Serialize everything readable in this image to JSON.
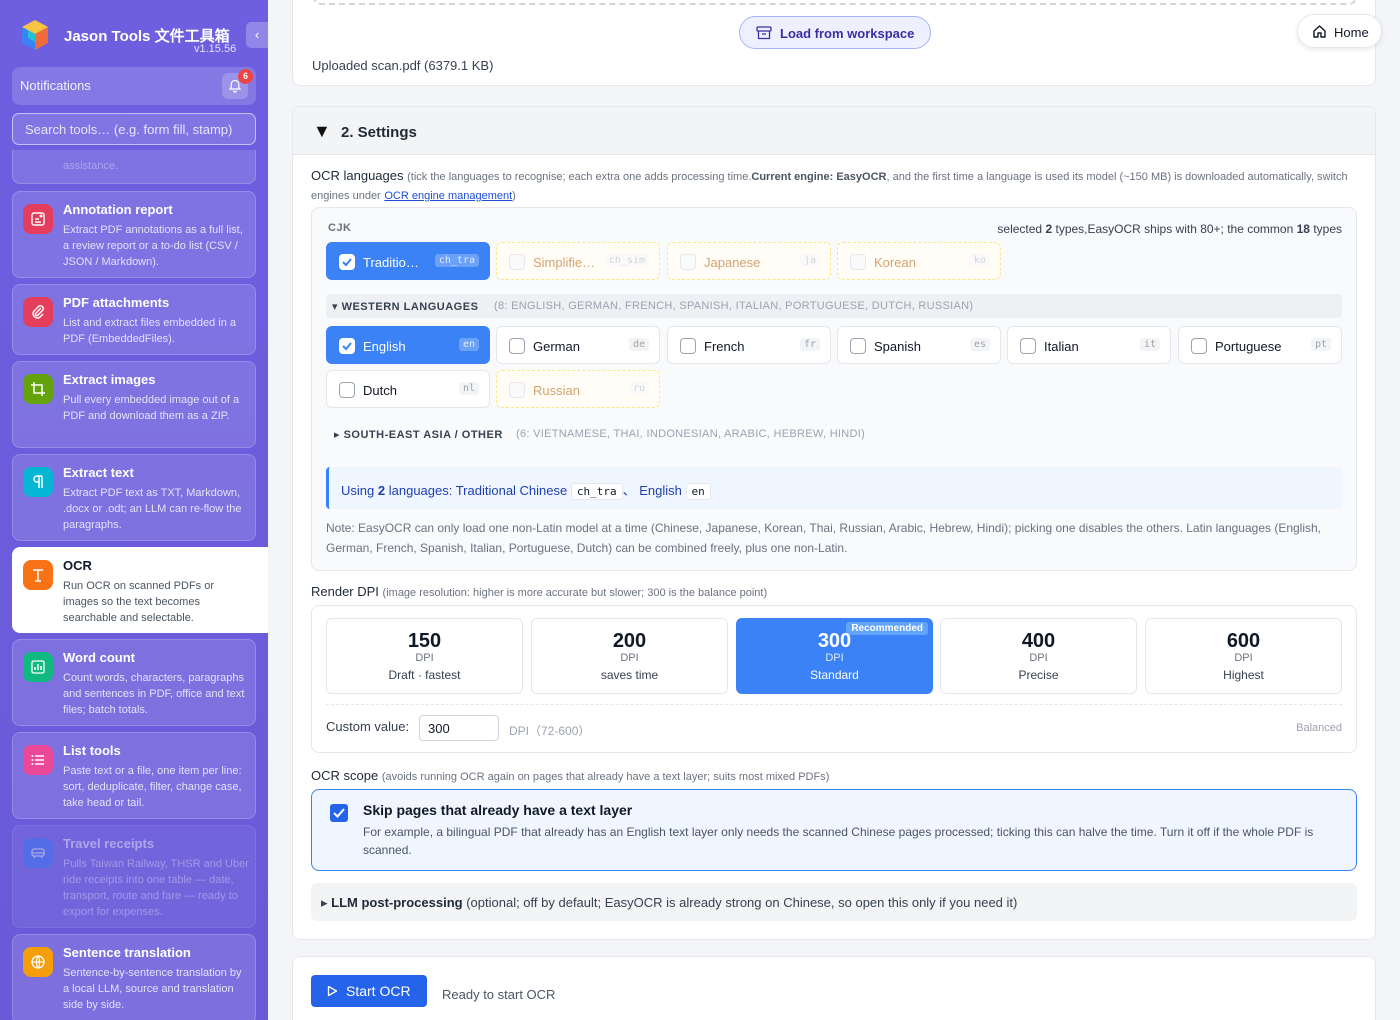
{
  "brand": {
    "title": "Jason Tools 文件工具箱",
    "version": "v1.15.56"
  },
  "sidebar": {
    "notifications_label": "Notifications",
    "notification_count": "6",
    "search_placeholder": "Search tools… (e.g. form fill, stamp)",
    "partial_text": "assistance.",
    "items": [
      {
        "title": "Annotation report",
        "desc": "Extract PDF annotations as a full list, a review report or a to-do list (CSV / JSON / Markdown).",
        "icon": "annotation-report-icon",
        "color": "#e53e5c"
      },
      {
        "title": "PDF attachments",
        "desc": "List and extract files embedded in a PDF (EmbeddedFiles).",
        "icon": "paperclip-icon",
        "color": "#e53e5c"
      },
      {
        "title": "Extract images",
        "desc": "Pull every embedded image out of a PDF and download them as a ZIP.",
        "icon": "crop-icon",
        "color": "#65a30d"
      },
      {
        "title": "Extract text",
        "desc": "Extract PDF text as TXT, Markdown, .docx or .odt; an LLM can re-flow the paragraphs.",
        "icon": "pilcrow-icon",
        "color": "#06b6d4"
      },
      {
        "title": "OCR",
        "desc": "Run OCR on scanned PDFs or images so the text becomes searchable and selectable.",
        "icon": "text-recognition-icon",
        "color": "#f97316"
      },
      {
        "title": "Word count",
        "desc": "Count words, characters, paragraphs and sentences in PDF, office and text files; batch totals.",
        "icon": "bar-chart-icon",
        "color": "#10b981"
      },
      {
        "title": "List tools",
        "desc": "Paste text or a file, one item per line: sort, deduplicate, filter, change case, take head or tail.",
        "icon": "list-icon",
        "color": "#ec4899"
      },
      {
        "title": "Travel receipts",
        "desc": "Pulls Taiwan Railway, THSR and Uber ride receipts into one table — date, transport, route and fare — ready to export for expenses.",
        "icon": "train-icon",
        "color": "#3b82f6"
      },
      {
        "title": "Sentence translation",
        "desc": "Sentence-by-sentence translation by a local LLM, source and translation side by side.",
        "icon": "globe-icon",
        "color": "#f59e0b"
      }
    ]
  },
  "header": {
    "home_label": "Home"
  },
  "upload": {
    "load_label": "Load from workspace",
    "uploaded_text": "Uploaded scan.pdf (6379.1 KB)"
  },
  "settings": {
    "title": "2. Settings",
    "ocr_lang_label": "OCR languages",
    "ocr_lang_hint_1": "(tick the languages to recognise; each extra one adds processing time.",
    "ocr_lang_engine": "Current engine: EasyOCR",
    "ocr_lang_hint_2": ", and the first time a language is used its model (~150 MB) is downloaded automatically, switch engines under",
    "ocr_lang_link": "OCR engine management",
    "ocr_lang_hint_3": ")",
    "cjk_label": "CJK",
    "selected_prefix": "selected",
    "selected_count": "2",
    "selected_mid": "types,EasyOCR ships with 80+; the common",
    "selected_common": "18",
    "selected_suffix": "types",
    "cjk": [
      {
        "name": "Traditio…",
        "code": "ch_tra",
        "state": "on"
      },
      {
        "name": "Simplifie…",
        "code": "ch_sim",
        "state": "disabled"
      },
      {
        "name": "Japanese",
        "code": "ja",
        "state": "disabled"
      },
      {
        "name": "Korean",
        "code": "ko",
        "state": "disabled"
      }
    ],
    "western_label": "WESTERN LANGUAGES",
    "western_sub": "(8: ENGLISH, GERMAN, FRENCH, SPANISH, ITALIAN, PORTUGUESE, DUTCH, RUSSIAN)",
    "western": [
      {
        "name": "English",
        "code": "en",
        "state": "on"
      },
      {
        "name": "German",
        "code": "de",
        "state": "off"
      },
      {
        "name": "French",
        "code": "fr",
        "state": "off"
      },
      {
        "name": "Spanish",
        "code": "es",
        "state": "off"
      },
      {
        "name": "Italian",
        "code": "it",
        "state": "off"
      },
      {
        "name": "Portuguese",
        "code": "pt",
        "state": "off"
      },
      {
        "name": "Dutch",
        "code": "nl",
        "state": "off"
      },
      {
        "name": "Russian",
        "code": "ru",
        "state": "disabled"
      }
    ],
    "sea_label": "SOUTH-EAST ASIA / OTHER",
    "sea_sub": "(6: VIETNAMESE, THAI, INDONESIAN, ARABIC, HEBREW, HINDI)",
    "using_prefix": "Using",
    "using_count": "2",
    "using_mid": "languages: Traditional Chinese",
    "using_code1": "ch_tra",
    "using_sep": "、",
    "using_lang2": "English",
    "using_code2": "en",
    "note": "Note: EasyOCR can only load one non-Latin model at a time (Chinese, Japanese, Korean, Thai, Russian, Arabic, Hebrew, Hindi); picking one disables the others. Latin languages (English, German, French, Spanish, Italian, Portuguese, Dutch) can be combined freely, plus one non-Latin.",
    "dpi_label": "Render DPI",
    "dpi_hint": "(image resolution: higher is more accurate but slower; 300 is the balance point)",
    "dpi_options": [
      {
        "value": "150",
        "unit": "DPI",
        "label": "Draft · fastest",
        "selected": false
      },
      {
        "value": "200",
        "unit": "DPI",
        "label": "saves time",
        "selected": false
      },
      {
        "value": "300",
        "unit": "DPI",
        "label": "Standard",
        "selected": true,
        "badge": "Recommended"
      },
      {
        "value": "400",
        "unit": "DPI",
        "label": "Precise",
        "selected": false
      },
      {
        "value": "600",
        "unit": "DPI",
        "label": "Highest",
        "selected": false
      }
    ],
    "custom_label": "Custom value:",
    "custom_value": "300",
    "custom_unit": "DPI（72-600）",
    "balanced": "Balanced",
    "scope_label": "OCR scope",
    "scope_hint": "(avoids running OCR again on pages that already have a text layer; suits most mixed PDFs)",
    "scope_title": "Skip pages that already have a text layer",
    "scope_desc": "For example, a bilingual PDF that already has an English text layer only needs the scanned Chinese pages processed; ticking this can halve the time. Turn it off if the whole PDF is scanned.",
    "llm_title": "LLM post-processing",
    "llm_desc": "(optional; off by default; EasyOCR is already strong on Chinese, so open this only if you need it)"
  },
  "run": {
    "start_label": "Start OCR",
    "status": "Ready to start OCR"
  },
  "colors": {
    "sidebar": "#6d5fe0",
    "accent": "#3b82f6",
    "primary_button": "#2563eb"
  }
}
